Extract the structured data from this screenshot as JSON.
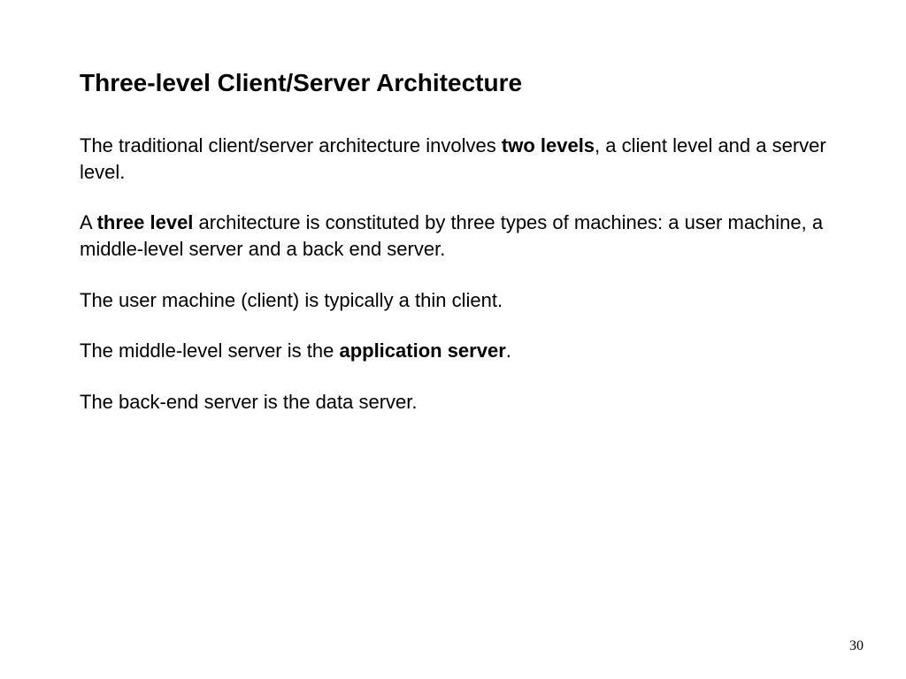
{
  "title": "Three-level Client/Server Architecture",
  "paragraphs": {
    "p1": {
      "s1": "The traditional client/server architecture involves ",
      "b1": "two levels",
      "s2": ", a client level and a server level."
    },
    "p2": {
      "s1": "A ",
      "b1": "three level",
      "s2": " architecture is constituted by three types of machines: a user machine, a middle-level server and a back end server."
    },
    "p3": {
      "s1": "The user machine (client) is typically a thin client."
    },
    "p4": {
      "s1": "The middle-level server is the ",
      "b1": "application server",
      "s2": "."
    },
    "p5": {
      "s1": "The back-end server is the data server."
    }
  },
  "page_number": "30"
}
